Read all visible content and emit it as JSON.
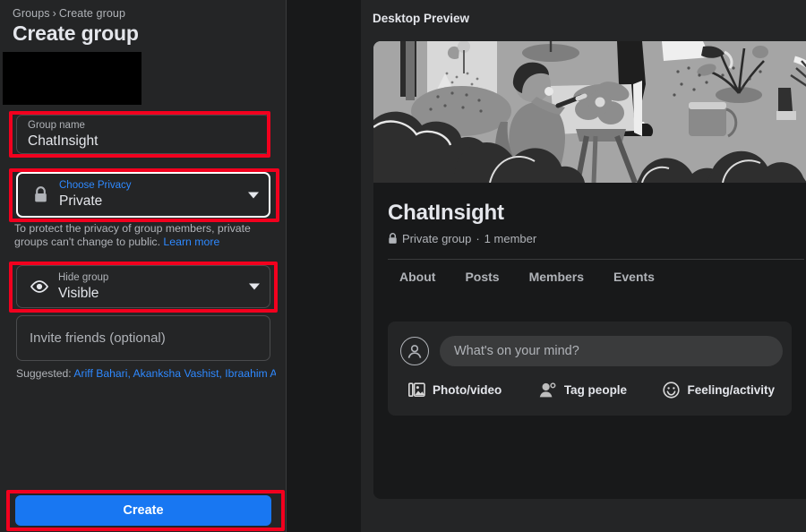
{
  "sidebar": {
    "breadcrumb": {
      "parent": "Groups",
      "separator": "›",
      "current": "Create group"
    },
    "page_title": "Create group",
    "avatar_block": "cover-photo-placeholder",
    "fields": {
      "group_name": {
        "label": "Group name",
        "value": "ChatInsight"
      },
      "privacy": {
        "label": "Choose Privacy",
        "value": "Private",
        "icon": "lock-icon"
      },
      "hide_group": {
        "label": "Hide group",
        "value": "Visible",
        "icon": "eye-icon"
      },
      "invite": {
        "placeholder": "Invite friends (optional)"
      }
    },
    "privacy_note": {
      "text": "To protect the privacy of group members, private groups can't change to public.",
      "link": "Learn more"
    },
    "suggested": {
      "label": "Suggested:",
      "names": "Ariff Bahari, Akanksha Vashist, Ibraahim Aalt..."
    },
    "create_button": "Create"
  },
  "preview": {
    "title": "Desktop Preview",
    "group_name": "ChatInsight",
    "meta": {
      "privacy": "Private group",
      "separator": "·",
      "members": "1 member",
      "icon": "lock-icon"
    },
    "tabs": [
      {
        "label": "About"
      },
      {
        "label": "Posts"
      },
      {
        "label": "Members"
      },
      {
        "label": "Events"
      }
    ],
    "composer": {
      "placeholder": "What's on your mind?",
      "actions": [
        {
          "label": "Photo/video",
          "icon": "photo-video-icon"
        },
        {
          "label": "Tag people",
          "icon": "tag-people-icon"
        },
        {
          "label": "Feeling/activity",
          "icon": "feeling-activity-icon"
        }
      ]
    },
    "cover_image": "people-gardening-painting-illustration-grayscale"
  },
  "annotations": {
    "boxes": [
      {
        "target": "group-name-field"
      },
      {
        "target": "privacy-field"
      },
      {
        "target": "hide-group-field"
      },
      {
        "target": "create-button"
      }
    ],
    "color": "#f2001e"
  },
  "colors": {
    "accent_blue": "#1877f2",
    "link_blue": "#2e89ff",
    "panel_bg": "#242526",
    "page_bg": "#18191a",
    "annotation_red": "#f2001e"
  }
}
